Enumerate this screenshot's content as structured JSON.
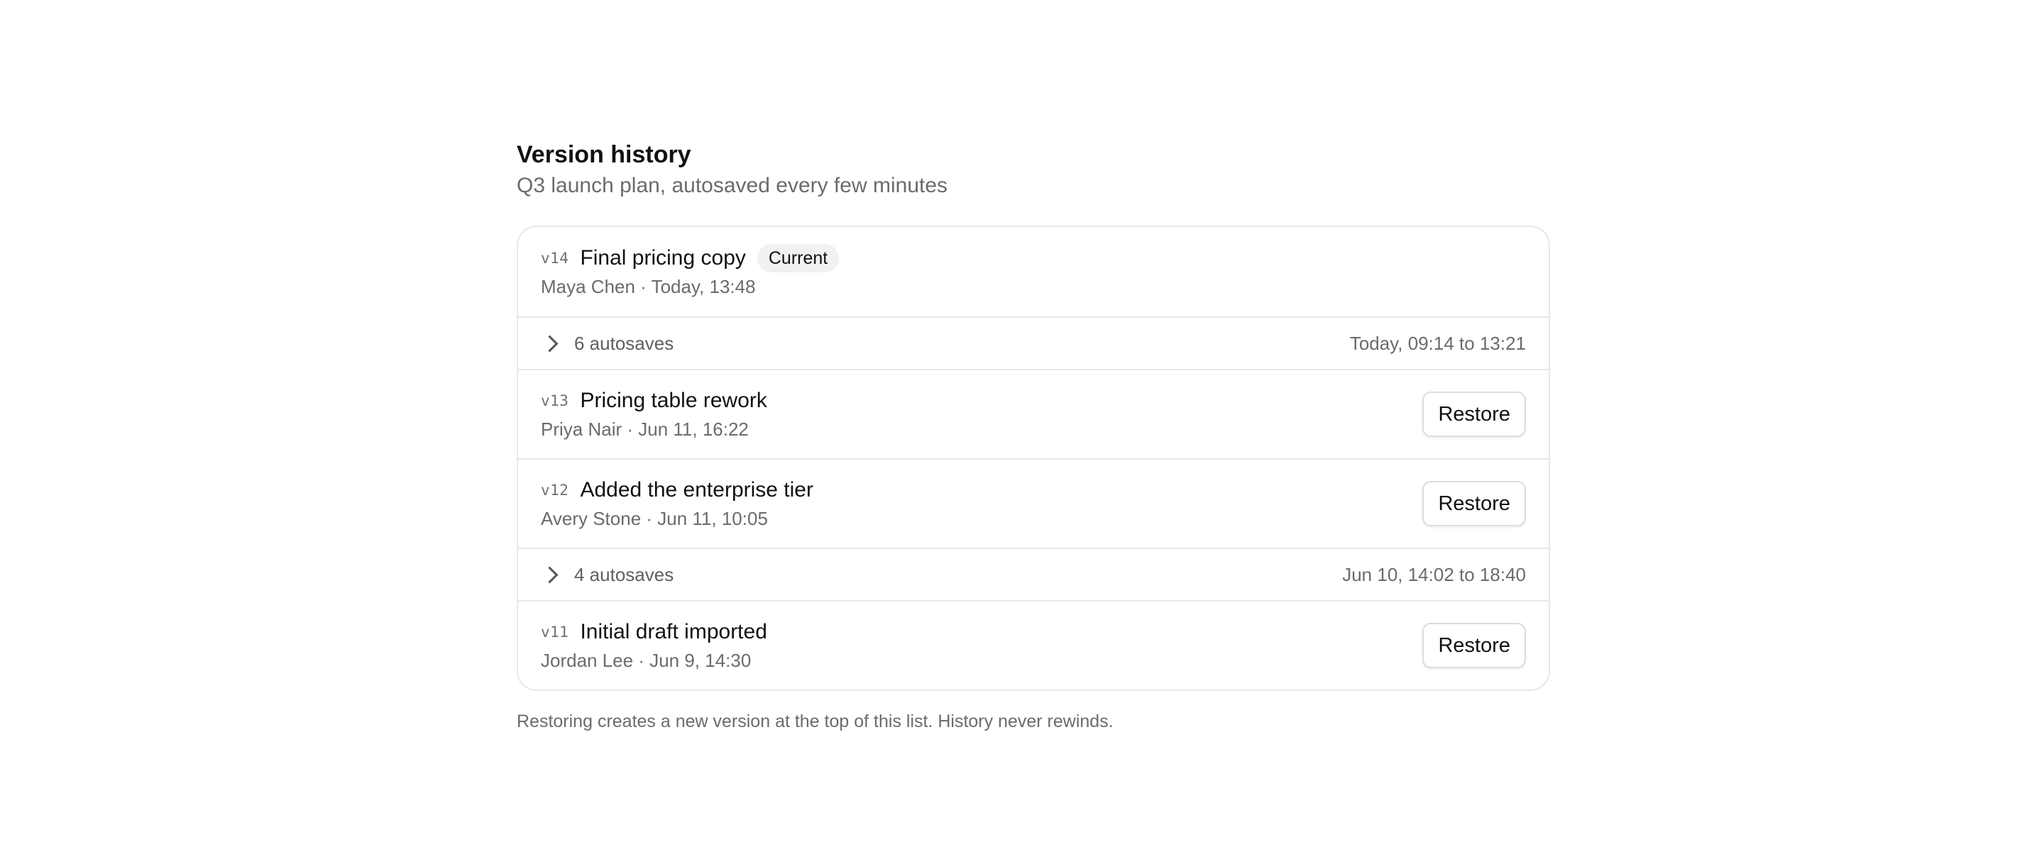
{
  "header": {
    "title": "Version history",
    "subtitle": "Q3 launch plan, autosaved every few minutes"
  },
  "versions": {
    "v14": {
      "number": "v14",
      "title": "Final pricing copy",
      "badge": "Current",
      "meta": "Maya Chen · Today, 13:48"
    },
    "group1": {
      "label": "6 autosaves",
      "range": "Today, 09:14 to 13:21"
    },
    "v13": {
      "number": "v13",
      "title": "Pricing table rework",
      "meta": "Priya Nair · Jun 11, 16:22",
      "action": "Restore"
    },
    "v12": {
      "number": "v12",
      "title": "Added the enterprise tier",
      "meta": "Avery Stone · Jun 11, 10:05",
      "action": "Restore"
    },
    "group2": {
      "label": "4 autosaves",
      "range": "Jun 10, 14:02 to 18:40"
    },
    "v11": {
      "number": "v11",
      "title": "Initial draft imported",
      "meta": "Jordan Lee · Jun 9, 14:30",
      "action": "Restore"
    }
  },
  "footnote": "Restoring creates a new version at the top of this list. History never rewinds.",
  "icons": {
    "group_toggle": "chevron-right-icon"
  }
}
